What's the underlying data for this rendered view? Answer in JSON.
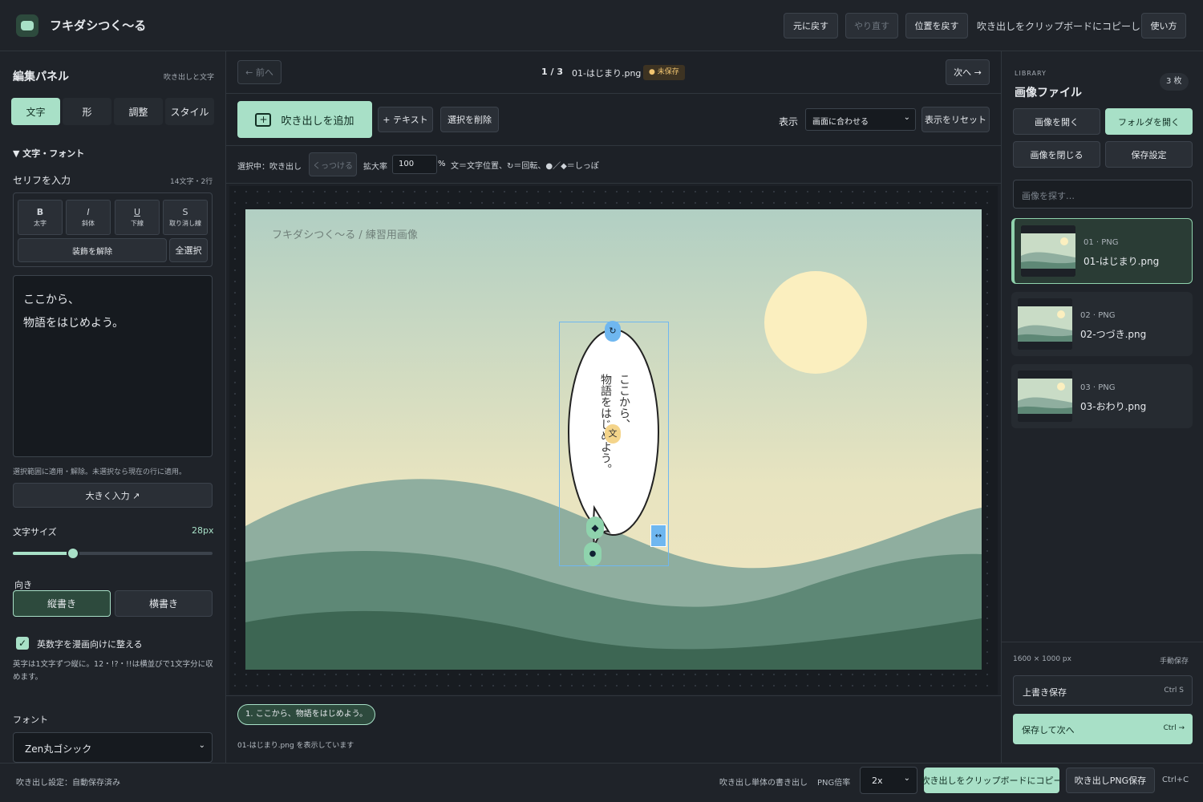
{
  "header": {
    "app_title": "フキダシつく〜る",
    "undo": "元に戻す",
    "redo": "やり直す",
    "reset_position": "位置を戻す",
    "status": "吹き出しをクリップボードにコピーしました",
    "help": "使い方"
  },
  "left": {
    "title": "編集パネル",
    "subtitle": "吹き出しと文字",
    "tabs": [
      "文字",
      "形",
      "調整",
      "スタイル"
    ],
    "section": "▼ 文字・フォント",
    "input_label": "セリフを入力",
    "input_count": "14文字・2行",
    "fmt": [
      {
        "glyph": "B",
        "label": "太字"
      },
      {
        "glyph": "I",
        "label": "斜体"
      },
      {
        "glyph": "U",
        "label": "下線"
      },
      {
        "glyph": "S",
        "label": "取り消し線"
      }
    ],
    "clear_format": "装飾を解除",
    "select_all": "全選択",
    "text_line1": "ここから、",
    "text_line2": "物語をはじめよう。",
    "hint": "選択範囲に適用・解除。未選択なら現在の行に適用。",
    "large_input": "大きく入力 ↗",
    "font_size_label": "文字サイズ",
    "font_size_value": "28px",
    "font_size_fraction": 0.3,
    "direction_label": "向き",
    "vertical": "縦書き",
    "horizontal": "横書き",
    "manga_label": "英数字を漫画向けに整える",
    "manga_desc": "英字は1文字ずつ縦に。12・!?・!!は横並びで1文字分に収めます。",
    "font_label": "フォント",
    "font_value": "Zen丸ゴシック"
  },
  "nav": {
    "prev": "← 前へ",
    "page": "1 / 3",
    "filename": "01-はじまり.png",
    "badge": "● 未保存",
    "next": "次へ →"
  },
  "toolbar": {
    "add_bubble": "吹き出しを追加",
    "add_text": "+ テキスト",
    "delete_selected": "選択を削除",
    "display_label": "表示",
    "display_value": "画面に合わせる",
    "reset_view": "表示をリセット"
  },
  "selbar": {
    "selected": "選択中：吹き出し",
    "attach": "くっつける",
    "zoom_label": "拡大率",
    "zoom_value": "100",
    "zoom_unit": "%",
    "legend": "文＝文字位置、↻＝回転、●／◆＝しっぽ"
  },
  "canvas": {
    "caption": "フキダシつく〜る / 練習用画像",
    "bubble_col1": "ここから、",
    "bubble_col2": "物語をはじめよう。",
    "text_handle": "文",
    "rotate_handle": "↻",
    "resize_handle": "↔"
  },
  "bottom": {
    "chip": "1. ここから、物語をはじめよう。",
    "status": "01-はじまり.png を表示しています"
  },
  "right": {
    "library": "LIBRARY",
    "title": "画像ファイル",
    "count": "3 枚",
    "open_image": "画像を開く",
    "open_folder": "フォルダを開く",
    "close_image": "画像を閉じる",
    "save_settings": "保存設定",
    "search_placeholder": "画像を探す…",
    "files": [
      {
        "meta": "01 · PNG",
        "name": "01-はじまり.png"
      },
      {
        "meta": "02 · PNG",
        "name": "02-つづき.png"
      },
      {
        "meta": "03 · PNG",
        "name": "03-おわり.png"
      }
    ],
    "dimensions": "1600 × 1000 px",
    "save_mode": "手動保存",
    "overwrite": "上書き保存",
    "overwrite_key": "Ctrl S",
    "save_next": "保存して次へ",
    "save_next_key": "Ctrl →"
  },
  "footer": {
    "status": "吹き出し設定：自動保存済み",
    "single_export": "吹き出し単体の書き出し",
    "png_label": "PNG倍率",
    "png_value": "2x",
    "copy": "吹き出しをクリップボードにコピー",
    "save_png": "吹き出しPNG保存",
    "shortcut": "Ctrl+C"
  }
}
